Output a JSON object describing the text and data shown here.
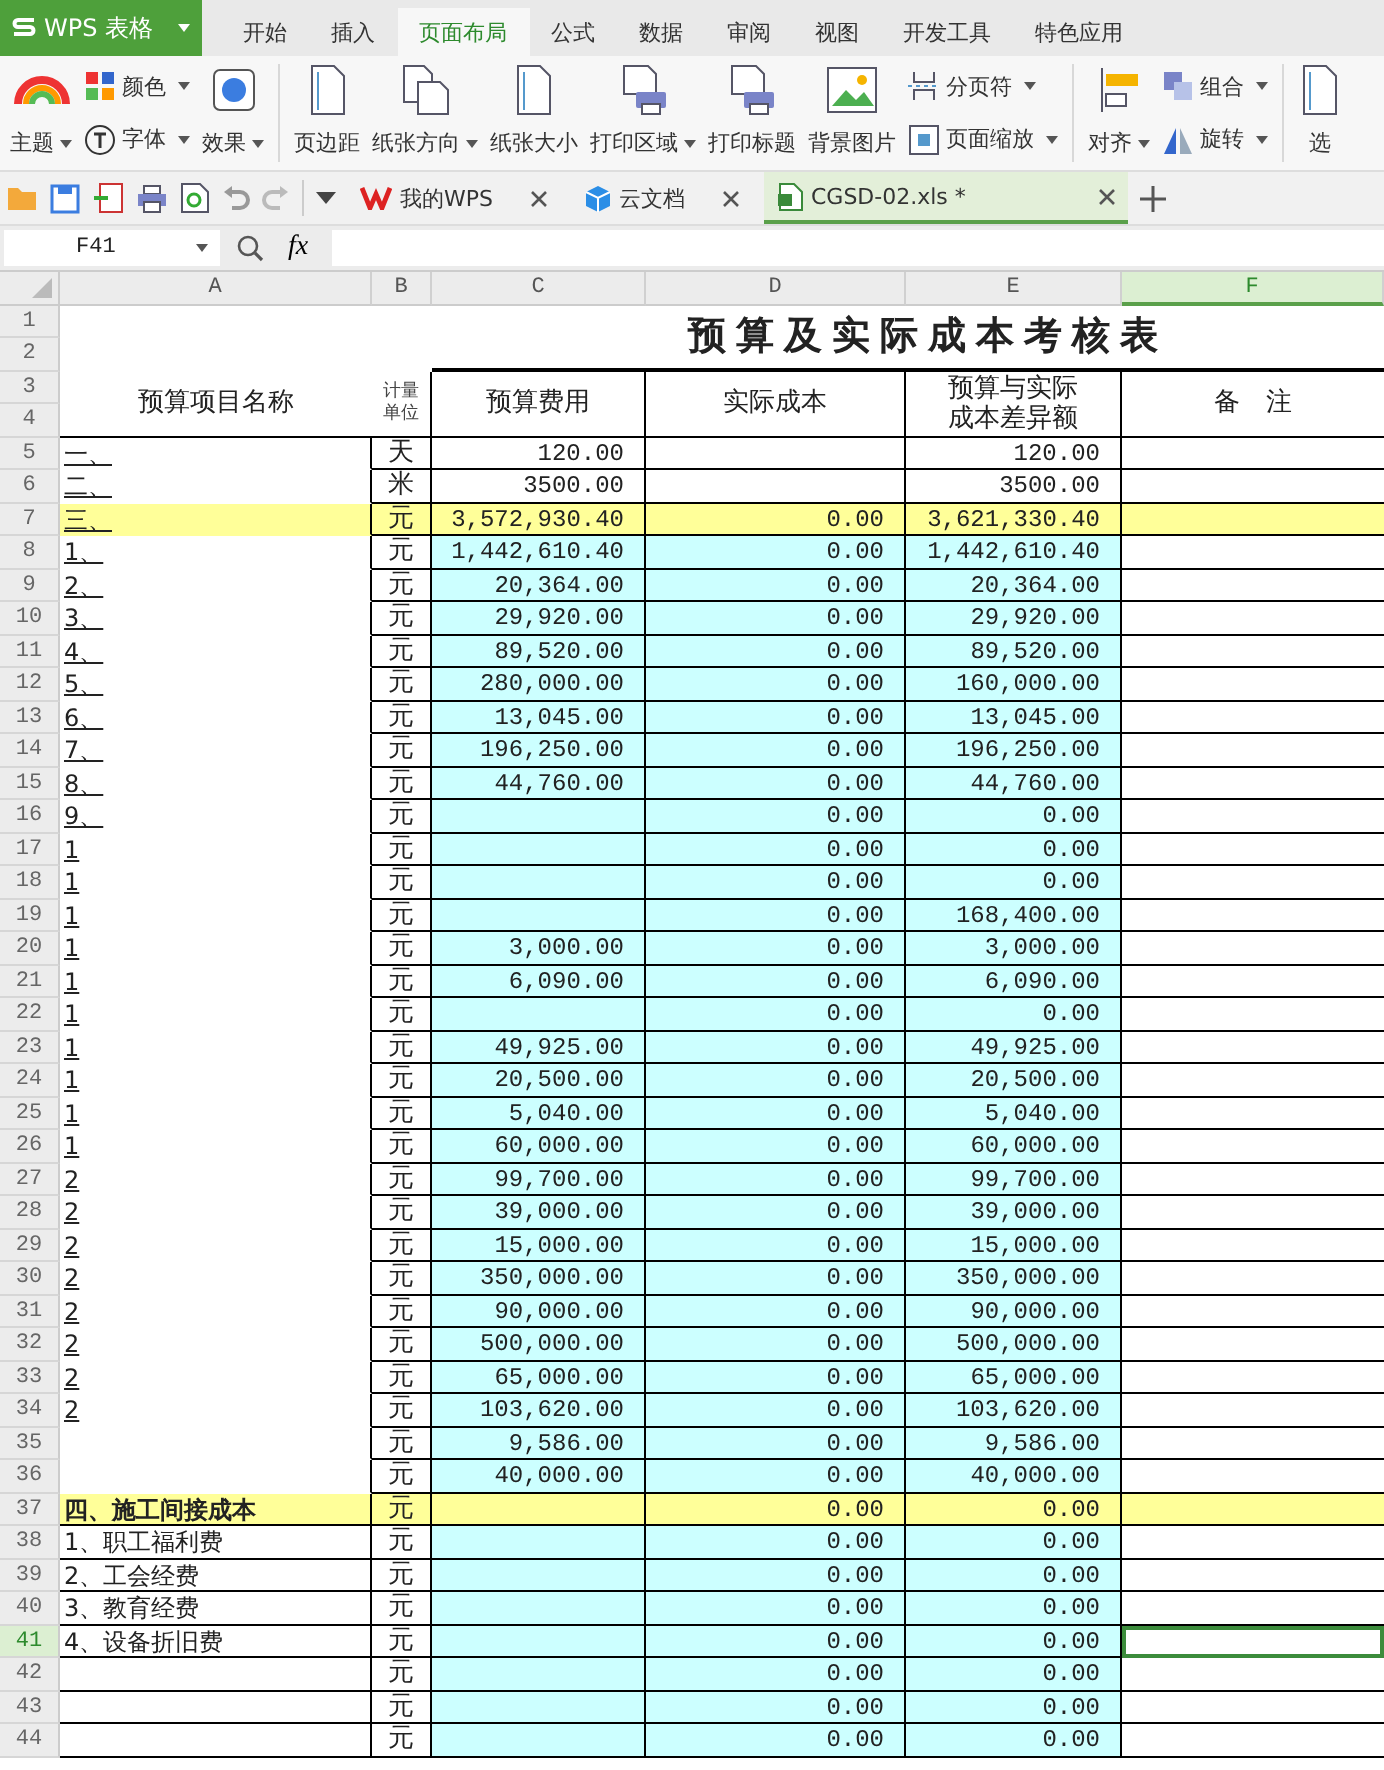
{
  "app_menu": {
    "label": "WPS 表格"
  },
  "tabs": [
    {
      "label": "开始",
      "selected": false
    },
    {
      "label": "插入",
      "selected": false
    },
    {
      "label": "页面布局",
      "selected": true
    },
    {
      "label": "公式",
      "selected": false
    },
    {
      "label": "数据",
      "selected": false
    },
    {
      "label": "审阅",
      "selected": false
    },
    {
      "label": "视图",
      "selected": false
    },
    {
      "label": "开发工具",
      "selected": false
    },
    {
      "label": "特色应用",
      "selected": false
    }
  ],
  "ribbon": [
    {
      "kind": "big",
      "label": "主题",
      "dropdown": true
    },
    {
      "kind": "pair",
      "items": [
        {
          "label": "颜色",
          "dropdown": true
        },
        {
          "label": "字体",
          "dropdown": true
        }
      ]
    },
    {
      "kind": "big",
      "label": "效果",
      "dropdown": true
    },
    {
      "kind": "sep"
    },
    {
      "kind": "big",
      "label": "页边距",
      "dropdown": false
    },
    {
      "kind": "big",
      "label": "纸张方向",
      "dropdown": true
    },
    {
      "kind": "big",
      "label": "纸张大小",
      "dropdown": false
    },
    {
      "kind": "big",
      "label": "打印区域",
      "dropdown": true
    },
    {
      "kind": "big",
      "label": "打印标题",
      "dropdown": false
    },
    {
      "kind": "big",
      "label": "背景图片",
      "dropdown": false
    },
    {
      "kind": "pair",
      "items": [
        {
          "label": "分页符",
          "dropdown": true
        },
        {
          "label": "页面缩放",
          "dropdown": true
        }
      ]
    },
    {
      "kind": "sep"
    },
    {
      "kind": "big",
      "label": "对齐",
      "dropdown": true
    },
    {
      "kind": "pair",
      "items": [
        {
          "label": "组合",
          "dropdown": true
        },
        {
          "label": "旋转",
          "dropdown": true
        }
      ]
    },
    {
      "kind": "sep"
    },
    {
      "kind": "big",
      "label": "选",
      "dropdown": false
    }
  ],
  "doc_tabs": [
    {
      "kind": "wps",
      "label": "我的WPS",
      "selected": false
    },
    {
      "kind": "cloud",
      "label": "云文档",
      "selected": false
    },
    {
      "kind": "sheet",
      "label": "CGSD-02.xls *",
      "selected": true
    }
  ],
  "formula_bar": {
    "name_box": "F41",
    "fx": "fx"
  },
  "columns": [
    {
      "label": "A",
      "selected": false
    },
    {
      "label": "B",
      "selected": false
    },
    {
      "label": "C",
      "selected": false
    },
    {
      "label": "D",
      "selected": false
    },
    {
      "label": "E",
      "selected": false
    },
    {
      "label": "F",
      "selected": true
    }
  ],
  "sheet": {
    "title": "预算及实际成本考核表",
    "header_rows": [
      "1",
      "2",
      "3",
      "4"
    ],
    "headers": [
      [
        "预算项目名称"
      ],
      [
        "计量",
        "单位"
      ],
      [
        "预算费用"
      ],
      [
        "实际成本"
      ],
      [
        "预算与实际",
        "成本差异额"
      ],
      [
        "备　注"
      ]
    ]
  },
  "rows": [
    {
      "num": "5",
      "kind": "plain",
      "selected": false,
      "a": "一、",
      "b": "天",
      "c": "120.00",
      "d": "",
      "e": "120.00"
    },
    {
      "num": "6",
      "kind": "plain",
      "selected": false,
      "a": "二、",
      "b": "米",
      "c": "3500.00",
      "d": "",
      "e": "3500.00"
    },
    {
      "num": "7",
      "kind": "total",
      "selected": false,
      "a": "三、",
      "b": "元",
      "c": "3,572,930.40",
      "d": "0.00",
      "e": "3,621,330.40"
    },
    {
      "num": "8",
      "kind": "item",
      "selected": false,
      "a": "1、",
      "b": "元",
      "c": "1,442,610.40",
      "d": "0.00",
      "e": "1,442,610.40"
    },
    {
      "num": "9",
      "kind": "item",
      "selected": false,
      "a": "2、",
      "b": "元",
      "c": "20,364.00",
      "d": "0.00",
      "e": "20,364.00"
    },
    {
      "num": "10",
      "kind": "item",
      "selected": false,
      "a": "3、",
      "b": "元",
      "c": "29,920.00",
      "d": "0.00",
      "e": "29,920.00"
    },
    {
      "num": "11",
      "kind": "item",
      "selected": false,
      "a": "4、",
      "b": "元",
      "c": "89,520.00",
      "d": "0.00",
      "e": "89,520.00"
    },
    {
      "num": "12",
      "kind": "item",
      "selected": false,
      "a": "5、",
      "b": "元",
      "c": "280,000.00",
      "d": "0.00",
      "e": "160,000.00"
    },
    {
      "num": "13",
      "kind": "item",
      "selected": false,
      "a": "6、",
      "b": "元",
      "c": "13,045.00",
      "d": "0.00",
      "e": "13,045.00"
    },
    {
      "num": "14",
      "kind": "item",
      "selected": false,
      "a": "7、",
      "b": "元",
      "c": "196,250.00",
      "d": "0.00",
      "e": "196,250.00"
    },
    {
      "num": "15",
      "kind": "item",
      "selected": false,
      "a": "8、",
      "b": "元",
      "c": "44,760.00",
      "d": "0.00",
      "e": "44,760.00"
    },
    {
      "num": "16",
      "kind": "item",
      "selected": false,
      "a": "9、",
      "b": "元",
      "c": "",
      "d": "0.00",
      "e": "0.00"
    },
    {
      "num": "17",
      "kind": "item",
      "selected": false,
      "a": "1",
      "b": "元",
      "c": "",
      "d": "0.00",
      "e": "0.00"
    },
    {
      "num": "18",
      "kind": "item",
      "selected": false,
      "a": "1",
      "b": "元",
      "c": "",
      "d": "0.00",
      "e": "0.00"
    },
    {
      "num": "19",
      "kind": "item",
      "selected": false,
      "a": "1",
      "b": "元",
      "c": "",
      "d": "0.00",
      "e": "168,400.00"
    },
    {
      "num": "20",
      "kind": "item",
      "selected": false,
      "a": "1",
      "b": "元",
      "c": "3,000.00",
      "d": "0.00",
      "e": "3,000.00"
    },
    {
      "num": "21",
      "kind": "item",
      "selected": false,
      "a": "1",
      "b": "元",
      "c": "6,090.00",
      "d": "0.00",
      "e": "6,090.00"
    },
    {
      "num": "22",
      "kind": "item",
      "selected": false,
      "a": "1",
      "b": "元",
      "c": "",
      "d": "0.00",
      "e": "0.00"
    },
    {
      "num": "23",
      "kind": "item",
      "selected": false,
      "a": "1",
      "b": "元",
      "c": "49,925.00",
      "d": "0.00",
      "e": "49,925.00"
    },
    {
      "num": "24",
      "kind": "item",
      "selected": false,
      "a": "1",
      "b": "元",
      "c": "20,500.00",
      "d": "0.00",
      "e": "20,500.00"
    },
    {
      "num": "25",
      "kind": "item",
      "selected": false,
      "a": "1",
      "b": "元",
      "c": "5,040.00",
      "d": "0.00",
      "e": "5,040.00"
    },
    {
      "num": "26",
      "kind": "item",
      "selected": false,
      "a": "1",
      "b": "元",
      "c": "60,000.00",
      "d": "0.00",
      "e": "60,000.00"
    },
    {
      "num": "27",
      "kind": "item",
      "selected": false,
      "a": "2",
      "b": "元",
      "c": "99,700.00",
      "d": "0.00",
      "e": "99,700.00"
    },
    {
      "num": "28",
      "kind": "item",
      "selected": false,
      "a": "2",
      "b": "元",
      "c": "39,000.00",
      "d": "0.00",
      "e": "39,000.00"
    },
    {
      "num": "29",
      "kind": "item",
      "selected": false,
      "a": "2",
      "b": "元",
      "c": "15,000.00",
      "d": "0.00",
      "e": "15,000.00"
    },
    {
      "num": "30",
      "kind": "item",
      "selected": false,
      "a": "2",
      "b": "元",
      "c": "350,000.00",
      "d": "0.00",
      "e": "350,000.00"
    },
    {
      "num": "31",
      "kind": "item",
      "selected": false,
      "a": "2",
      "b": "元",
      "c": "90,000.00",
      "d": "0.00",
      "e": "90,000.00"
    },
    {
      "num": "32",
      "kind": "item",
      "selected": false,
      "a": "2",
      "b": "元",
      "c": "500,000.00",
      "d": "0.00",
      "e": "500,000.00"
    },
    {
      "num": "33",
      "kind": "item",
      "selected": false,
      "a": "2",
      "b": "元",
      "c": "65,000.00",
      "d": "0.00",
      "e": "65,000.00"
    },
    {
      "num": "34",
      "kind": "item",
      "selected": false,
      "a": "2",
      "b": "元",
      "c": "103,620.00",
      "d": "0.00",
      "e": "103,620.00"
    },
    {
      "num": "35",
      "kind": "item",
      "selected": false,
      "a": "",
      "b": "元",
      "c": "9,586.00",
      "d": "0.00",
      "e": "9,586.00"
    },
    {
      "num": "36",
      "kind": "item",
      "selected": false,
      "a": "",
      "b": "元",
      "c": "40,000.00",
      "d": "0.00",
      "e": "40,000.00"
    },
    {
      "num": "37",
      "kind": "section",
      "selected": false,
      "a": "四、施工间接成本",
      "b": "元",
      "c": "",
      "d": "0.00",
      "e": "0.00"
    },
    {
      "num": "38",
      "kind": "sub",
      "selected": false,
      "a": "1、职工福利费",
      "b": "元",
      "c": "",
      "d": "0.00",
      "e": "0.00"
    },
    {
      "num": "39",
      "kind": "sub",
      "selected": false,
      "a": "2、工会经费",
      "b": "元",
      "c": "",
      "d": "0.00",
      "e": "0.00"
    },
    {
      "num": "40",
      "kind": "sub",
      "selected": false,
      "a": "3、教育经费",
      "b": "元",
      "c": "",
      "d": "0.00",
      "e": "0.00"
    },
    {
      "num": "41",
      "kind": "sub",
      "selected": true,
      "a": "4、设备折旧费",
      "b": "元",
      "c": "",
      "d": "0.00",
      "e": "0.00"
    },
    {
      "num": "42",
      "kind": "sub",
      "selected": false,
      "a": "",
      "b": "元",
      "c": "",
      "d": "0.00",
      "e": "0.00"
    },
    {
      "num": "43",
      "kind": "sub",
      "selected": false,
      "a": "",
      "b": "元",
      "c": "",
      "d": "0.00",
      "e": "0.00"
    },
    {
      "num": "44",
      "kind": "sub",
      "selected": false,
      "a": "",
      "b": "元",
      "c": "",
      "d": "0.00",
      "e": "0.00"
    }
  ]
}
